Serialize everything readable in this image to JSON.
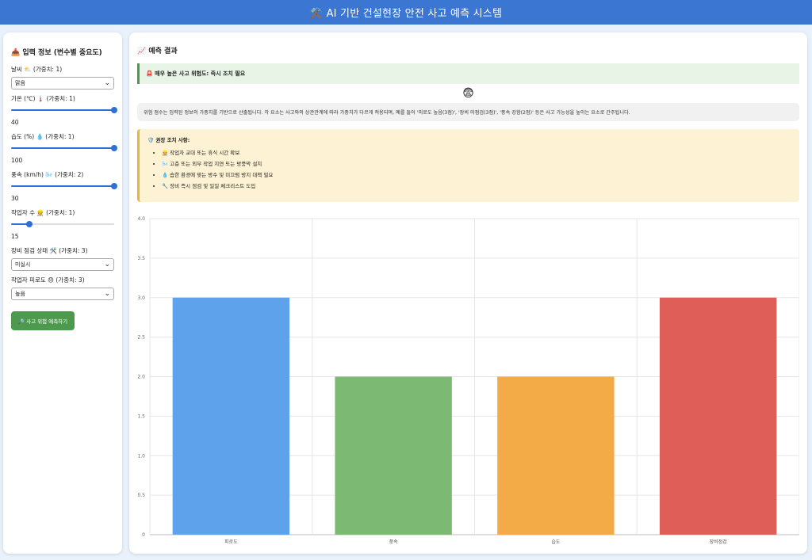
{
  "header": {
    "title": "⚒️ AI 기반 건설현장 안전 사고 예측 시스템"
  },
  "sidebar": {
    "title": "📥 입력 정보 (변수별 중요도)",
    "weather": {
      "label": "날씨 ⛅ (가중치: 1)",
      "value": "맑음"
    },
    "temperature": {
      "label": "기온 (℃) 🌡️ (가중치: 1)",
      "value": "40",
      "fraction": 1.0
    },
    "humidity": {
      "label": "습도 (%) 💧 (가중치: 1)",
      "value": "100",
      "fraction": 1.0
    },
    "wind": {
      "label": "풍속 (km/h) 🌬️ (가중치: 2)",
      "value": "30",
      "fraction": 1.0
    },
    "workers": {
      "label": "작업자 수 👷 (가중치: 1)",
      "value": "15",
      "fraction": 0.18
    },
    "equipment": {
      "label": "장비 점검 상태 🛠️ (가중치: 3)",
      "value": "미실시"
    },
    "fatigue": {
      "label": "작업자 피로도 😓 (가중치: 3)",
      "value": "높음"
    },
    "predict_button": "🔎 사고 위험 예측하기"
  },
  "main": {
    "title": "📈 예측 결과",
    "alert": "🚨 매우 높은 사고 위험도: 즉시 조치 필요",
    "status_emoji": "😨",
    "info": "위험 점수는 입력된 정보의 가중치를 기반으로 산출됩니다. 각 요소는 사고와의 상관관계에 따라 가중치가 다르게 적용되며, 예를 들어 '피로도 높음(3점)', '장비 미점검(3점)', '풍속 강함(2점)' 등은 사고 가능성을 높이는 요소로 간주됩니다.",
    "recommend_title": "🛡️ 권장 조치 사항:",
    "recommend_items": [
      "👷 작업자 교대 또는 휴식 시간 확보",
      "🌬️ 고층 또는 외부 작업 지연 또는 방풍막 설치",
      "💧 습한 환경에 맞는 방수 및 미끄럼 방지 대책 필요",
      "🔧 장비 즉시 점검 및 일일 체크리스트 도입"
    ]
  },
  "chart_data": {
    "type": "bar",
    "categories": [
      "피로도",
      "풍속",
      "습도",
      "장비점검"
    ],
    "values": [
      3,
      2,
      2,
      3
    ],
    "colors": [
      "#5ea2ec",
      "#7cba73",
      "#f2ab47",
      "#df5f58"
    ],
    "ylim": [
      0,
      4
    ],
    "yticks": [
      "0",
      "0.5",
      "1.0",
      "1.5",
      "2.0",
      "2.5",
      "3.0",
      "3.5",
      "4.0"
    ],
    "grid": true
  }
}
